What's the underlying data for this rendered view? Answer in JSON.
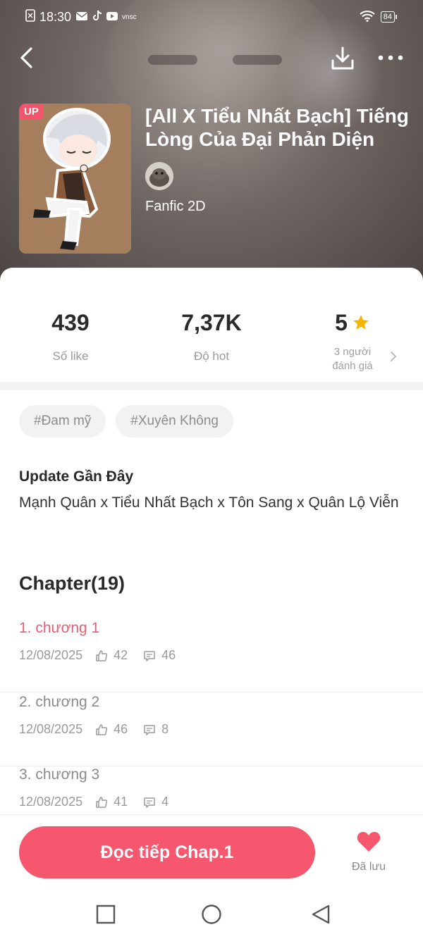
{
  "status_bar": {
    "time": "18:30",
    "network_label": "vnsc",
    "battery": "84"
  },
  "header": {
    "up_badge": "UP",
    "title": "[All X Tiểu Nhất Bạch] Tiếng Lòng Của Đại Phản Diện",
    "category": "Fanfic 2D"
  },
  "stats": {
    "likes": {
      "value": "439",
      "label": "Số like"
    },
    "hot": {
      "value": "7,37K",
      "label": "Độ hot"
    },
    "rating": {
      "value": "5",
      "line1": "3 người",
      "line2": "đánh giá"
    }
  },
  "tags": [
    "#Đam mỹ",
    "#Xuyên Không"
  ],
  "update": {
    "heading": "Update Gần Đây",
    "text": "Mạnh Quân x Tiểu Nhất Bạch x Tôn Sang x Quân Lộ Viễn"
  },
  "chapters_heading": "Chapter(19)",
  "chapters": [
    {
      "title": "1. chương 1",
      "date": "12/08/2025",
      "likes": "42",
      "comments": "46",
      "active": true
    },
    {
      "title": "2. chương 2",
      "date": "12/08/2025",
      "likes": "46",
      "comments": "8",
      "active": false
    },
    {
      "title": "3. chương 3",
      "date": "12/08/2025",
      "likes": "41",
      "comments": "4",
      "active": false
    }
  ],
  "bottom": {
    "read_button": "Đọc tiếp Chap.1",
    "saved_label": "Đã lưu"
  },
  "colors": {
    "accent": "#f6566e",
    "active_chapter": "#e85d72",
    "star": "#f5b400"
  },
  "icons": [
    "back-icon",
    "download-icon",
    "more-icon",
    "star-icon",
    "chevron-right-icon",
    "thumbs-up-icon",
    "comment-icon",
    "heart-icon",
    "square-nav-icon",
    "circle-nav-icon",
    "triangle-nav-icon"
  ]
}
